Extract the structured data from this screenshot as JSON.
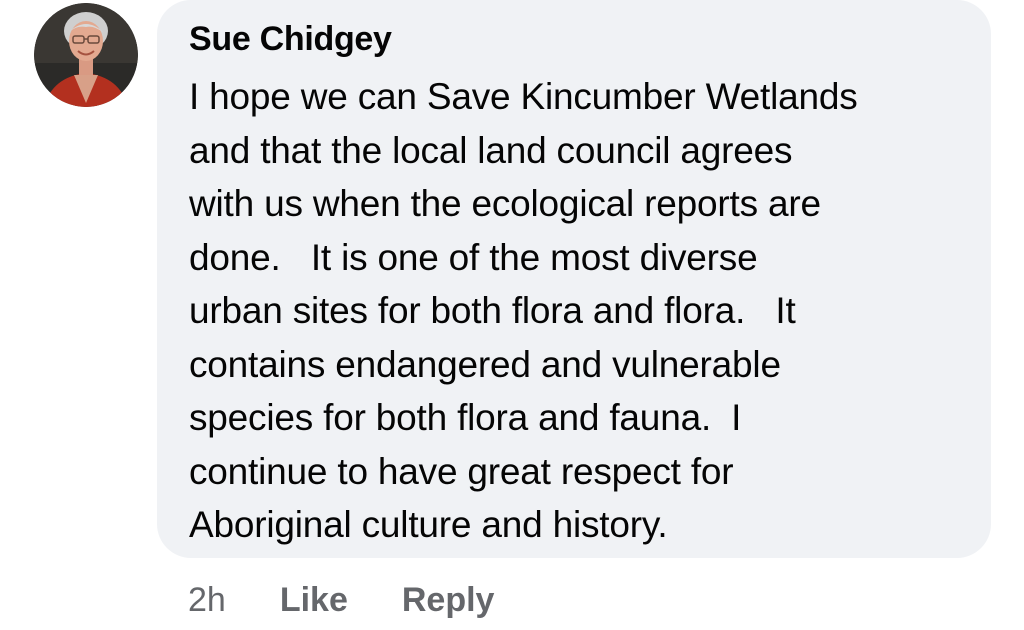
{
  "comment": {
    "author": "Sue Chidgey",
    "text_lines": [
      "I hope we can Save Kincumber Wetlands",
      "and that the local land council agrees",
      "with us when the ecological reports are",
      "done.   It is one of the most diverse",
      "urban sites for both flora and flora.   It",
      "contains endangered and vulnerable",
      "species for both flora and fauna.  I",
      "continue to have great respect for",
      "Aboriginal culture and history."
    ],
    "timestamp": "2h",
    "like_label": "Like",
    "reply_label": "Reply"
  },
  "colors": {
    "bubble_background": "#f0f2f5",
    "text": "#050505",
    "secondary_text": "#65676b"
  },
  "avatar": {
    "icon": "profile-photo"
  }
}
